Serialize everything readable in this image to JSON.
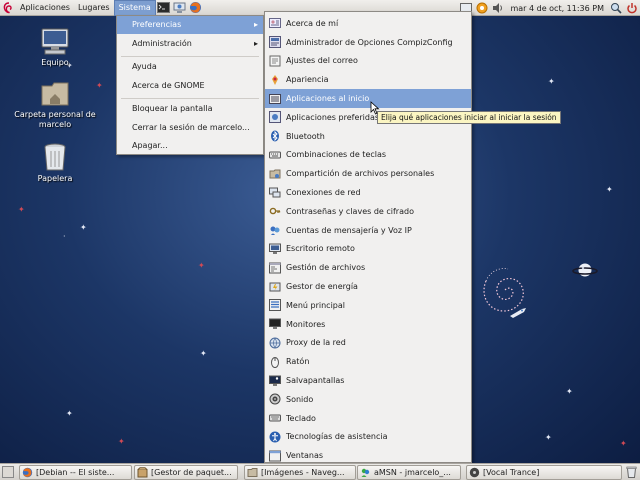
{
  "top_panel": {
    "menus": [
      "Aplicaciones",
      "Lugares",
      "Sistema"
    ],
    "clock": "mar  4 de oct, 11:36 PM",
    "launchers": [
      "terminal-icon",
      "network-icon",
      "firefox-icon"
    ],
    "tray": [
      "network-status-icon",
      "update-notifier-icon",
      "volume-icon",
      "search-icon",
      "shutdown-icon"
    ]
  },
  "desktop_icons": [
    {
      "label": "Equipo",
      "icon": "computer-icon"
    },
    {
      "label": "Carpeta personal de marcelo",
      "icon": "home-folder-icon"
    },
    {
      "label": "Papelera",
      "icon": "trash-icon"
    }
  ],
  "system_menu": {
    "items": [
      {
        "label": "Preferencias",
        "submenu": true,
        "active": true
      },
      {
        "label": "Administración",
        "submenu": true
      },
      {
        "label": "Ayuda"
      },
      {
        "label": "Acerca de GNOME"
      },
      {
        "label": "Bloquear la pantalla"
      },
      {
        "label": "Cerrar la sesión de marcelo..."
      },
      {
        "label": "Apagar..."
      }
    ],
    "arrow": "▸"
  },
  "preferences_menu": {
    "items": [
      {
        "label": "Acerca de mí",
        "icon": "about-me-icon"
      },
      {
        "label": "Administrador de Opciones CompizConfig",
        "icon": "compizconfig-icon"
      },
      {
        "label": "Ajustes del correo",
        "icon": "mail-settings-icon"
      },
      {
        "label": "Apariencia",
        "icon": "appearance-icon"
      },
      {
        "label": "Aplicaciones al inicio",
        "icon": "startup-apps-icon",
        "active": true
      },
      {
        "label": "Aplicaciones preferidas",
        "icon": "preferred-apps-icon"
      },
      {
        "label": "Bluetooth",
        "icon": "bluetooth-icon"
      },
      {
        "label": "Combinaciones de teclas",
        "icon": "keyboard-shortcuts-icon"
      },
      {
        "label": "Compartición de archivos personales",
        "icon": "file-sharing-icon"
      },
      {
        "label": "Conexiones de red",
        "icon": "network-connections-icon"
      },
      {
        "label": "Contraseñas y claves de cifrado",
        "icon": "passwords-keys-icon"
      },
      {
        "label": "Cuentas de mensajería y Voz IP",
        "icon": "messaging-accounts-icon"
      },
      {
        "label": "Escritorio remoto",
        "icon": "remote-desktop-icon"
      },
      {
        "label": "Gestión de archivos",
        "icon": "file-management-icon"
      },
      {
        "label": "Gestor de energía",
        "icon": "power-manager-icon"
      },
      {
        "label": "Menú principal",
        "icon": "main-menu-icon"
      },
      {
        "label": "Monitores",
        "icon": "monitors-icon"
      },
      {
        "label": "Proxy de la red",
        "icon": "network-proxy-icon"
      },
      {
        "label": "Ratón",
        "icon": "mouse-icon"
      },
      {
        "label": "Salvapantallas",
        "icon": "screensaver-icon"
      },
      {
        "label": "Sonido",
        "icon": "sound-icon"
      },
      {
        "label": "Teclado",
        "icon": "keyboard-icon"
      },
      {
        "label": "Tecnologías de asistencia",
        "icon": "accessibility-icon"
      },
      {
        "label": "Ventanas",
        "icon": "windows-icon"
      }
    ]
  },
  "tooltip": "Elija qué aplicaciones iniciar al iniciar la sesión",
  "taskbar": [
    {
      "label": "[Debian -- El siste...",
      "icon": "firefox-icon"
    },
    {
      "label": "[Gestor de paquet...",
      "icon": "package-manager-icon"
    },
    {
      "label": "[Imágenes - Naveg...",
      "icon": "file-browser-icon"
    },
    {
      "label": "aMSN - jmarcelo_...",
      "icon": "amsn-icon"
    },
    {
      "label": "[Vocal Trance]",
      "icon": "music-player-icon"
    }
  ],
  "colors": {
    "selection": "#7ea1d6",
    "panel": "#e6e4e0",
    "desktop": "#1c3666",
    "tooltip": "#fbf5c2"
  }
}
